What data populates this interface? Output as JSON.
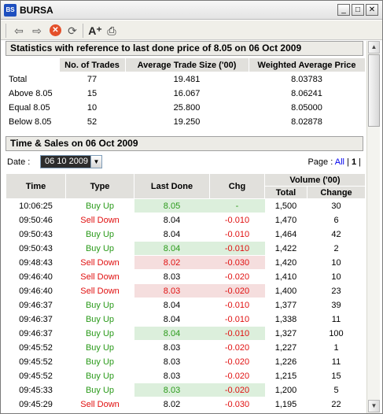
{
  "window": {
    "title": "BURSA",
    "icon_text": "BS",
    "buttons": {
      "minimize": "_",
      "maximize": "□",
      "close": "✕"
    }
  },
  "toolbar": {
    "back": "⇦",
    "forward": "⇨",
    "stop": "✕",
    "refresh": "⟳",
    "font": "A⁺",
    "print": "⎙"
  },
  "stats": {
    "heading": "Statistics with reference to last done price of 8.05 on 06 Oct 2009",
    "columns": [
      "",
      "No. of Trades",
      "Average Trade Size ('00)",
      "Weighted Average Price"
    ],
    "rows": [
      [
        "Total",
        "77",
        "19.481",
        "8.03783"
      ],
      [
        "Above 8.05",
        "15",
        "16.067",
        "8.06241"
      ],
      [
        "Equal 8.05",
        "10",
        "25.800",
        "8.05000"
      ],
      [
        "Below 8.05",
        "52",
        "19.250",
        "8.02878"
      ]
    ]
  },
  "time_sales": {
    "heading": "Time & Sales on 06 Oct 2009",
    "date_label": "Date :",
    "date_value": "06 10 2009",
    "date_button": "▼",
    "page_label": "Page :",
    "page_all": "All",
    "page_sep": "|",
    "page_current": "1",
    "page_end": "|",
    "columns": {
      "time": "Time",
      "type": "Type",
      "last_done": "Last Done",
      "chg": "Chg",
      "volume": "Volume ('00)",
      "total": "Total",
      "change": "Change"
    },
    "rows": [
      [
        "10:06:25",
        "Buy Up",
        "8.05",
        "-",
        "1,500",
        "30"
      ],
      [
        "09:50:46",
        "Sell Down",
        "8.04",
        "-0.010",
        "1,470",
        "6"
      ],
      [
        "09:50:43",
        "Buy Up",
        "8.04",
        "-0.010",
        "1,464",
        "42"
      ],
      [
        "09:50:43",
        "Buy Up",
        "8.04",
        "-0.010",
        "1,422",
        "2"
      ],
      [
        "09:48:43",
        "Sell Down",
        "8.02",
        "-0.030",
        "1,420",
        "10"
      ],
      [
        "09:46:40",
        "Sell Down",
        "8.03",
        "-0.020",
        "1,410",
        "10"
      ],
      [
        "09:46:40",
        "Sell Down",
        "8.03",
        "-0.020",
        "1,400",
        "23"
      ],
      [
        "09:46:37",
        "Buy Up",
        "8.04",
        "-0.010",
        "1,377",
        "39"
      ],
      [
        "09:46:37",
        "Buy Up",
        "8.04",
        "-0.010",
        "1,338",
        "11"
      ],
      [
        "09:46:37",
        "Buy Up",
        "8.04",
        "-0.010",
        "1,327",
        "100"
      ],
      [
        "09:45:52",
        "Buy Up",
        "8.03",
        "-0.020",
        "1,227",
        "1"
      ],
      [
        "09:45:52",
        "Buy Up",
        "8.03",
        "-0.020",
        "1,226",
        "11"
      ],
      [
        "09:45:52",
        "Buy Up",
        "8.03",
        "-0.020",
        "1,215",
        "15"
      ],
      [
        "09:45:33",
        "Buy Up",
        "8.03",
        "-0.020",
        "1,200",
        "5"
      ],
      [
        "09:45:29",
        "Sell Down",
        "8.02",
        "-0.030",
        "1,195",
        "22"
      ]
    ],
    "highlight": [
      "up",
      "",
      "",
      "up",
      "down",
      "",
      "down",
      "",
      "",
      "up",
      "",
      "",
      "",
      "up",
      ""
    ]
  },
  "scrollbar": {
    "up": "▲",
    "down": "▼"
  },
  "colors": {
    "buy": "#2a9a1a",
    "sell": "#e01010",
    "up_bg": "#dcefdc",
    "down_bg": "#f5dede"
  }
}
